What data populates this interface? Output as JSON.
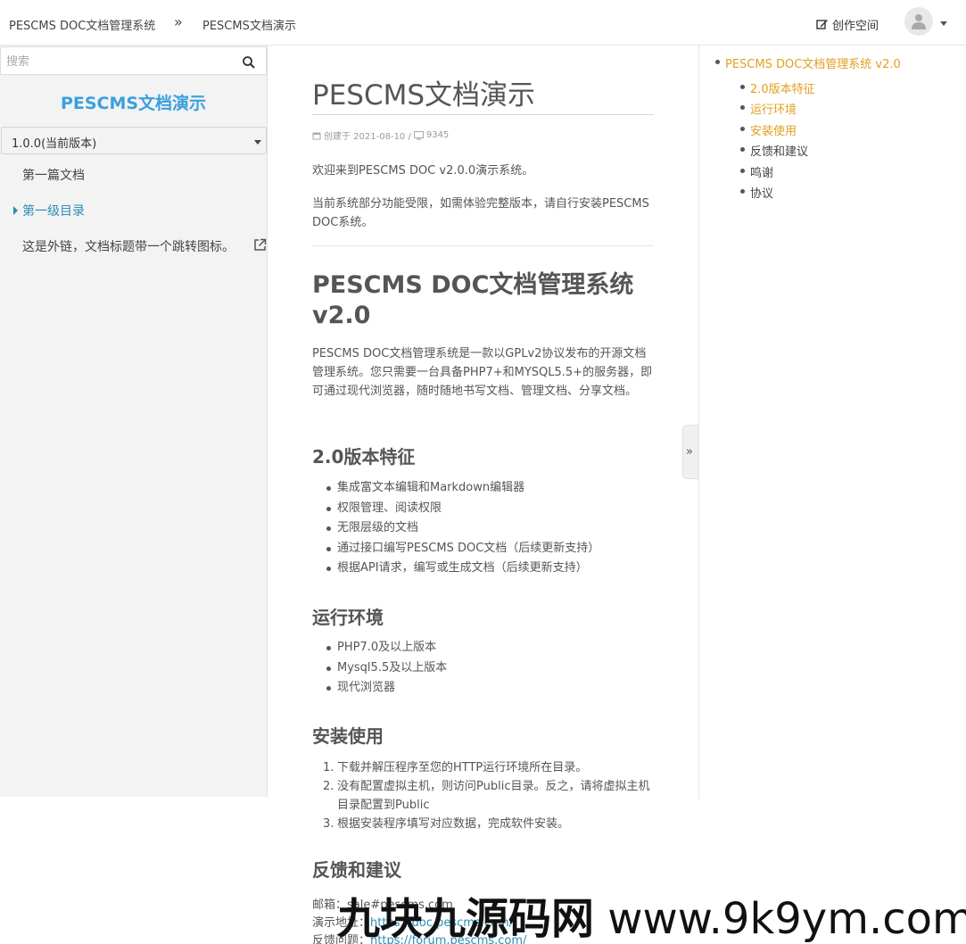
{
  "header": {
    "breadcrumb_root": "PESCMS DOC文档管理系统",
    "breadcrumb_separator": "»",
    "breadcrumb_current": "PESCMS文档演示",
    "create_space": "创作空间",
    "avatar_icon": "user-icon"
  },
  "sidebar": {
    "search_placeholder": "搜索",
    "brand": "PESCMS文档演示",
    "version": "1.0.0(当前版本)",
    "items": [
      {
        "label": "第一篇文档",
        "active": false
      },
      {
        "label": "第一级目录",
        "active": true
      },
      {
        "label": "这是外链，文档标题带一个跳转图标。",
        "active": false,
        "external": true
      }
    ]
  },
  "article": {
    "title": "PESCMS文档演示",
    "created_label": "创建于 2021-08-10 /",
    "views": "9345",
    "intro1": "欢迎来到PESCMS DOC v2.0.0演示系统。",
    "intro2": "当前系统部分功能受限，如需体验完整版本，请自行安装PESCMS DOC系统。",
    "h1": "PESCMS DOC文档管理系统 v2.0",
    "h1_para": "PESCMS DOC文档管理系统是一款以GPLv2协议发布的开源文档管理系统。您只需要一台具备PHP7+和MYSQL5.5+的服务器，即可通过现代浏览器，随时随地书写文档、管理文档、分享文档。",
    "features_title": "2.0版本特征",
    "features": [
      "集成富文本编辑和Markdown编辑器",
      "权限管理、阅读权限",
      "无限层级的文档",
      "通过接口编写PESCMS DOC文档（后续更新支持）",
      "根据API请求，编写或生成文档（后续更新支持）"
    ],
    "env_title": "运行环境",
    "env": [
      "PHP7.0及以上版本",
      "Mysql5.5及以上版本",
      "现代浏览器"
    ],
    "install_title": "安装使用",
    "install": [
      "下载并解压程序至您的HTTP运行环境所在目录。",
      "没有配置虚拟主机，则访问Public目录。反之，请将虚拟主机目录配置到Public",
      "根据安装程序填写对应数据，完成软件安装。"
    ],
    "feedback_title": "反馈和建议",
    "email_label": "邮箱：",
    "email_value": "sale#pescms.com",
    "demo_label": "演示地址：",
    "demo_value": "https://doc.pescms.com/",
    "feedback_label": "反馈问题：",
    "feedback_value": "https://forum.pescms.com/"
  },
  "toggle": "»",
  "toc": {
    "root": "PESCMS DOC文档管理系统 v2.0",
    "items": [
      {
        "label": "2.0版本特征",
        "link": true
      },
      {
        "label": "运行环境",
        "link": true
      },
      {
        "label": "安装使用",
        "link": true
      },
      {
        "label": "反馈和建议",
        "link": false
      },
      {
        "label": "鸣谢",
        "link": false
      },
      {
        "label": "协议",
        "link": false
      }
    ]
  },
  "watermark": {
    "cn": "九块九源码网",
    "url": "www.9k9ym.com"
  },
  "colors": {
    "brand_blue": "#3aa0dd",
    "active_link": "#2a8fb5",
    "toc_link": "#e0a020"
  }
}
